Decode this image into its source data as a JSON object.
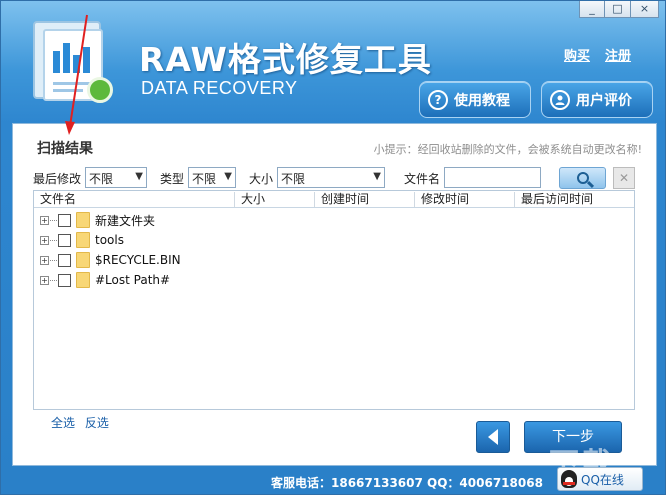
{
  "window": {
    "controls": [
      "_",
      "□",
      "×"
    ]
  },
  "header": {
    "title": "RAW格式修复工具",
    "subtitle": "DATA RECOVERY",
    "buy_link": "购买",
    "register_link": "注册",
    "tutorial_label": "使用教程",
    "tutorial_icon": "?",
    "review_label": "用户评价"
  },
  "scan": {
    "title": "扫描结果",
    "hint": "小提示：经回收站删除的文件，会被系统自动更改名称!"
  },
  "filters": {
    "modified_label": "最后修改",
    "modified_value": "不限",
    "type_label": "类型",
    "type_value": "不限",
    "size_label": "大小",
    "size_value": "不限",
    "filename_label": "文件名",
    "filename_value": ""
  },
  "table": {
    "columns": [
      "文件名",
      "大小",
      "创建时间",
      "修改时间",
      "最后访问时间"
    ],
    "rows": [
      {
        "name": "新建文件夹"
      },
      {
        "name": "tools"
      },
      {
        "name": "$RECYCLE.BIN"
      },
      {
        "name": "#Lost Path#"
      }
    ]
  },
  "selection": {
    "select_all": "全选",
    "invert": "反选"
  },
  "nav": {
    "next_label": "下一步"
  },
  "footer": {
    "contact": "客服电话：18667133607 QQ：4006718068",
    "qq_label": "QQ在线",
    "watermark": "下载"
  },
  "colors": {
    "annotation_arrow": "#e02020",
    "accent_blue": "#2a80c8"
  }
}
